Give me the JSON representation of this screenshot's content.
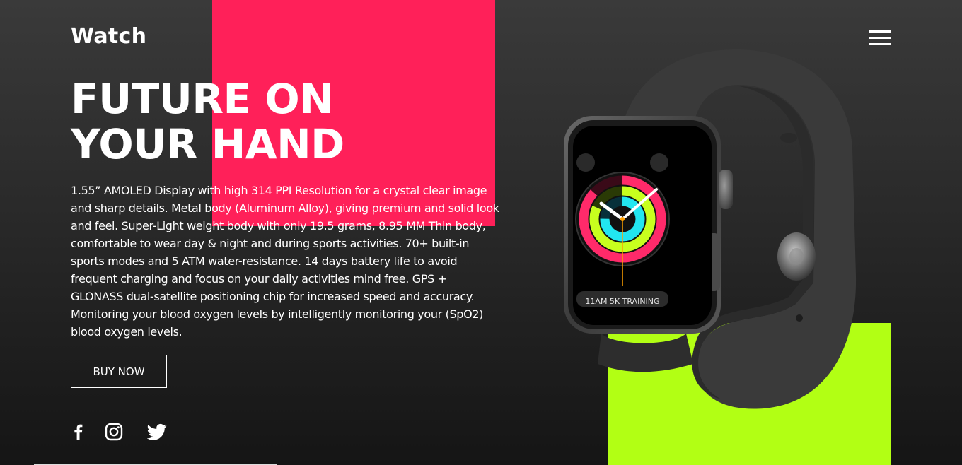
{
  "header": {
    "logo": "Watch",
    "menu_icon": "hamburger-menu-icon"
  },
  "hero": {
    "headline_line1": "FUTURE ON",
    "headline_line2": "YOUR HAND",
    "description": "1.55” AMOLED Display with high 314 PPI Resolution for a crystal clear image and sharp details. Metal body (Aluminum Alloy), giving premium and solid look and feel. Super-Light weight body with only 19.5 grams, 8.95 MM Thin body, comfortable to wear day & night and during sports activities. 70+ built-in sports modes and 5 ATM water-resistance. 14 days battery life to avoid frequent charging and focus on your daily activities mind free. GPS + GLONASS dual-satellite positioning chip for increased speed and accuracy. Monitoring your blood oxygen levels by intelligently monitoring your (SpO2) blood oxygen levels.",
    "cta_label": "BUY NOW"
  },
  "social": [
    {
      "icon": "facebook-icon"
    },
    {
      "icon": "instagram-icon"
    },
    {
      "icon": "twitter-icon"
    }
  ],
  "product_image": {
    "watch_face_text": "11AM 5K TRAINING"
  },
  "colors": {
    "accent_pink": "#ff2059",
    "accent_lime": "#b2ff14",
    "background_top": "#3a3a3a",
    "background_bottom": "#151515",
    "text": "#ffffff"
  }
}
